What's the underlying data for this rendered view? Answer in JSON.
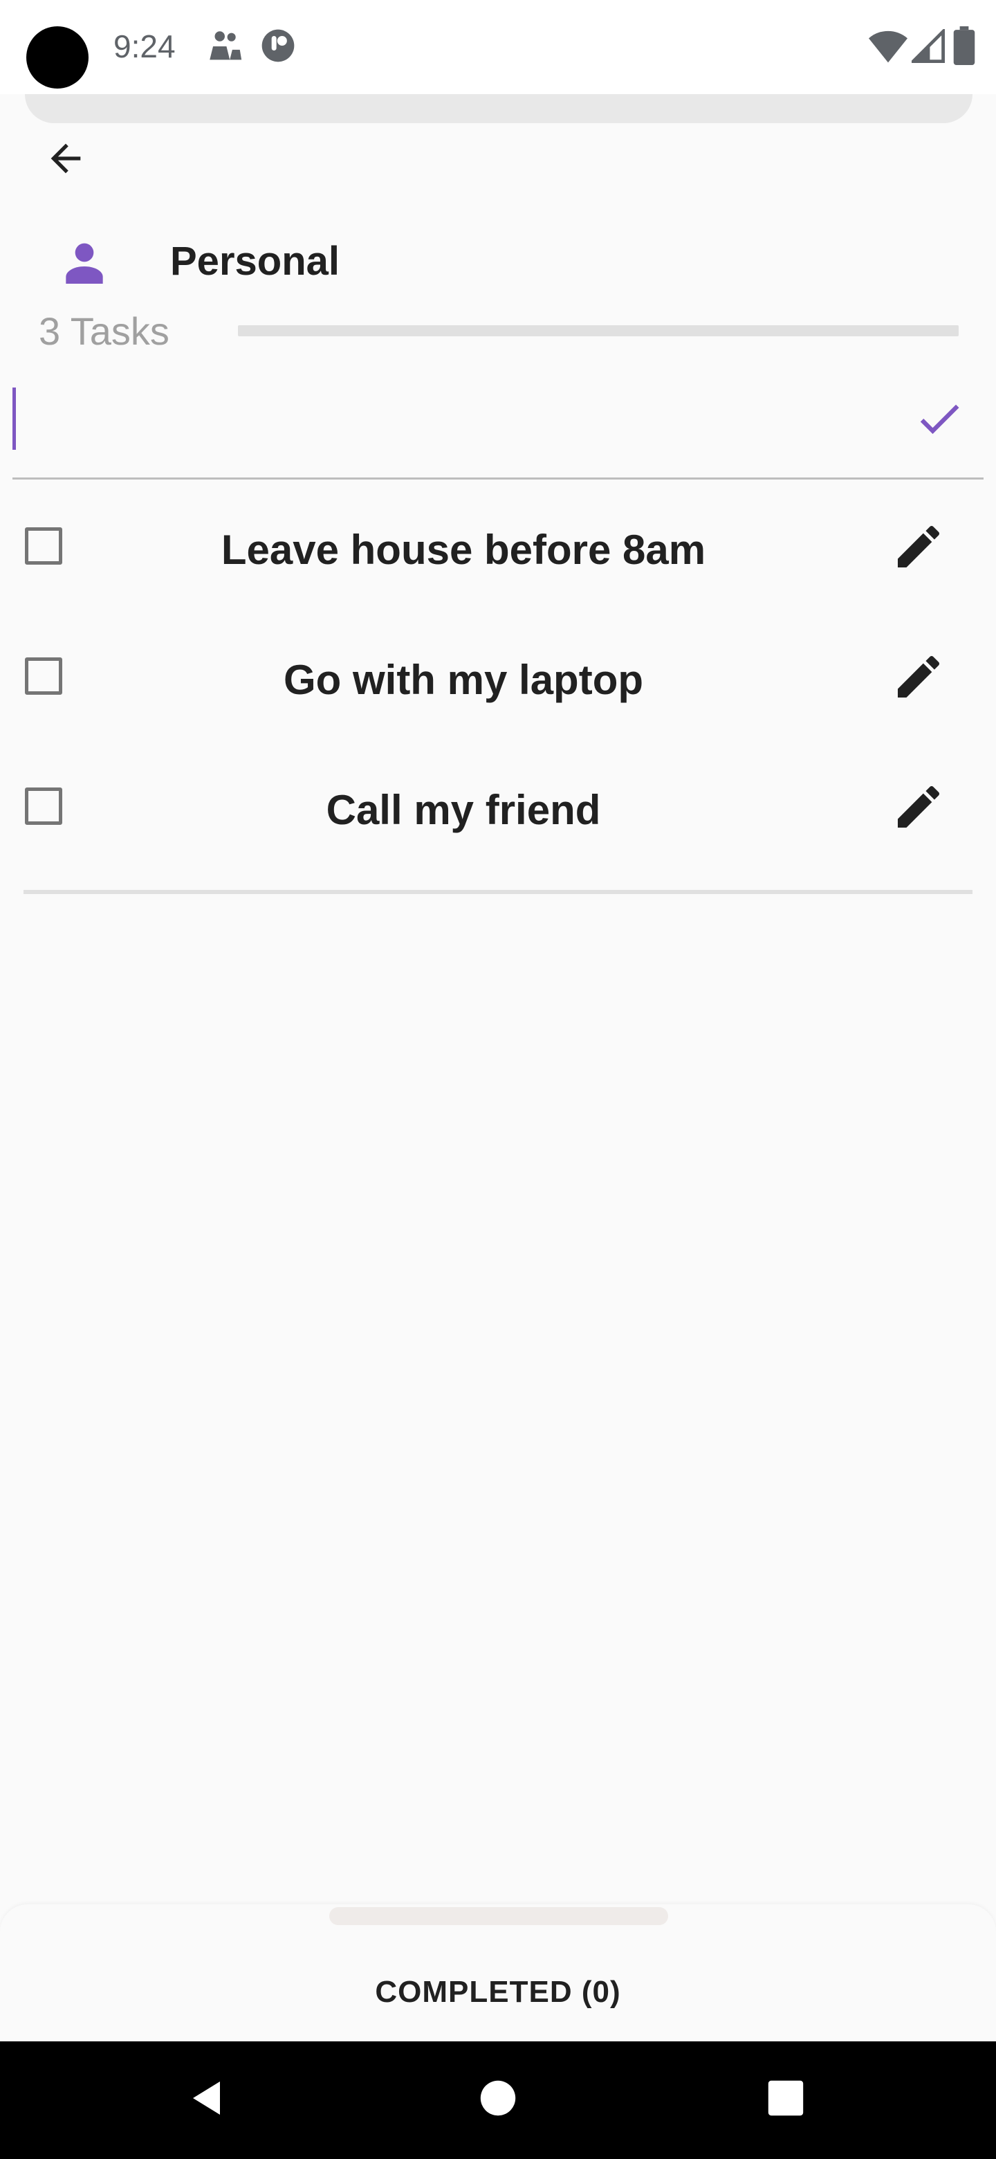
{
  "status_bar": {
    "time": "9:24",
    "icons": [
      "camera-cutout",
      "notification-app-icon",
      "notification-pocket-icon",
      "wifi-icon",
      "cellular-signal-icon",
      "battery-icon"
    ]
  },
  "header": {
    "back_icon": "arrow-back-icon",
    "list_icon": "person-icon",
    "list_title": "Personal",
    "task_count": "3 Tasks",
    "progress": 0
  },
  "new_task": {
    "value": "",
    "placeholder": "",
    "confirm_icon": "check-icon"
  },
  "tasks": [
    {
      "label": "Leave house before 8am",
      "checked": false,
      "edit_icon": "pencil-icon"
    },
    {
      "label": "Go with my laptop",
      "checked": false,
      "edit_icon": "pencil-icon"
    },
    {
      "label": "Call my friend",
      "checked": false,
      "edit_icon": "pencil-icon"
    }
  ],
  "completed_sheet": {
    "label": "COMPLETED (0)"
  },
  "nav_bar": {
    "buttons": [
      "back-triangle-icon",
      "home-circle-icon",
      "recents-square-icon"
    ]
  },
  "colors": {
    "accent": "#7E57C2",
    "text": "#212121",
    "muted": "#A0A0A0",
    "background": "#FAFAFA"
  }
}
